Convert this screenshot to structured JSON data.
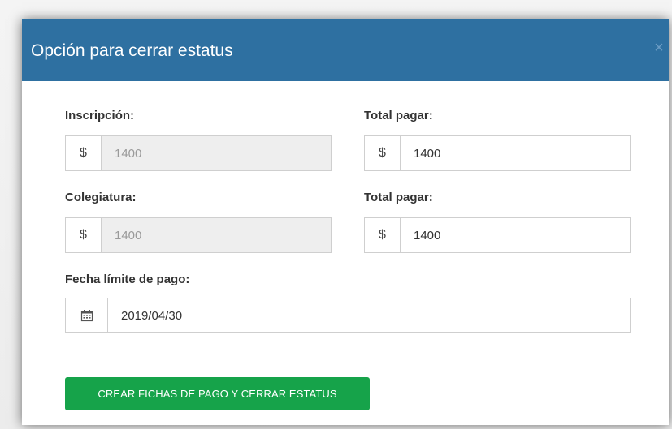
{
  "modal": {
    "title": "Opción para cerrar estatus",
    "close_symbol": "×"
  },
  "form": {
    "inscripcion": {
      "label": "Inscripción:",
      "currency": "$",
      "value": "1400",
      "disabled": true
    },
    "total_pagar_1": {
      "label": "Total pagar:",
      "currency": "$",
      "value": "1400"
    },
    "colegiatura": {
      "label": "Colegiatura:",
      "currency": "$",
      "value": "1400",
      "disabled": true
    },
    "total_pagar_2": {
      "label": "Total pagar:",
      "currency": "$",
      "value": "1400"
    },
    "fecha_limite": {
      "label": "Fecha límite de pago:",
      "icon": "calendar-icon",
      "value": "2019/04/30"
    }
  },
  "actions": {
    "submit_label": "CREAR FICHAS DE PAGO Y CERRAR ESTATUS"
  },
  "colors": {
    "header": "#2e70a1",
    "button": "#16a34a",
    "disabled_input": "#eeeeee"
  }
}
